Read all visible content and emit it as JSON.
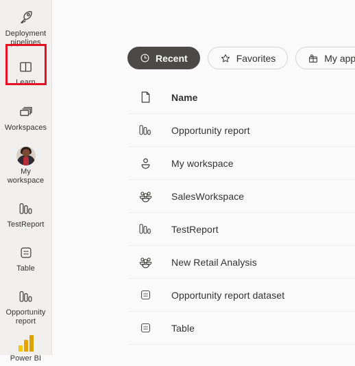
{
  "sidebar": {
    "items": [
      {
        "label": "Deployment pipelines",
        "icon": "rocket-icon",
        "name": "deployment-pipelines"
      },
      {
        "label": "Learn",
        "icon": "book-icon",
        "name": "learn",
        "highlighted": true
      },
      {
        "label": "Workspaces",
        "icon": "workspaces-icon",
        "name": "workspaces"
      },
      {
        "label": "My workspace",
        "icon": "avatar-icon",
        "name": "my-workspace"
      },
      {
        "label": "TestReport",
        "icon": "report-icon",
        "name": "testreport"
      },
      {
        "label": "Table",
        "icon": "dataset-icon",
        "name": "table"
      },
      {
        "label": "Opportunity report",
        "icon": "report-icon",
        "name": "opportunity-report"
      }
    ],
    "footer": {
      "label": "Power BI",
      "icon": "power-bi-logo",
      "name": "power-bi"
    },
    "highlight_color": "#e81123"
  },
  "toolbar": {
    "pills": [
      {
        "label": "Recent",
        "icon": "clock-icon",
        "selected": true
      },
      {
        "label": "Favorites",
        "icon": "star-icon",
        "selected": false
      },
      {
        "label": "My apps",
        "icon": "apps-icon",
        "selected": false
      }
    ]
  },
  "list": {
    "header": {
      "label": "Name",
      "icon": "file-icon"
    },
    "rows": [
      {
        "label": "Opportunity report",
        "icon": "report-icon"
      },
      {
        "label": "My workspace",
        "icon": "person-icon"
      },
      {
        "label": "SalesWorkspace",
        "icon": "group-icon"
      },
      {
        "label": "TestReport",
        "icon": "report-icon"
      },
      {
        "label": "New Retail Analysis",
        "icon": "group-icon"
      },
      {
        "label": "Opportunity report dataset",
        "icon": "dataset-icon"
      },
      {
        "label": "Table",
        "icon": "dataset-icon"
      }
    ]
  }
}
